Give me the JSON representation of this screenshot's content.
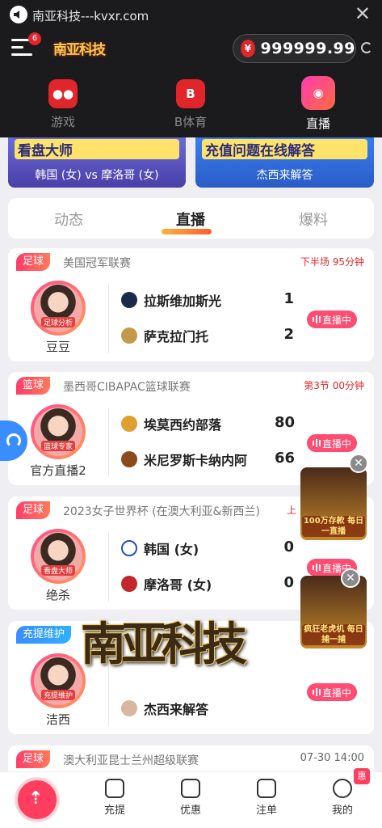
{
  "browser": {
    "url": "南亚科技---kvxr.com"
  },
  "header": {
    "menu_badge": "6",
    "logo": "南亚科技",
    "currency": "¥",
    "balance": "999999.99"
  },
  "categories": [
    {
      "label": "游戏"
    },
    {
      "label": "B体育"
    },
    {
      "label": "直播"
    }
  ],
  "banners": [
    {
      "title": "看盘大师",
      "label": "韩国 (女) vs 摩洛哥 (女)"
    },
    {
      "title": "充值问题在线解答",
      "label": "杰西来解答"
    }
  ],
  "tabs": [
    "动态",
    "直播",
    "爆料"
  ],
  "cards": [
    {
      "sport": "足球",
      "league": "美国冠军联赛",
      "status": "下半场 95分钟",
      "anchor": "豆豆",
      "avatar_text": "足球分析",
      "home": "拉斯维加斯光",
      "away": "萨克拉门托",
      "home_score": "1",
      "away_score": "2",
      "live": "直播中"
    },
    {
      "sport": "篮球",
      "league": "墨西哥CIBAPAC篮球联赛",
      "status": "第3节 00分钟",
      "anchor": "官方直播2",
      "avatar_text": "篮球专家",
      "home": "埃莫西约部落",
      "away": "米尼罗斯卡纳内阿",
      "home_score": "80",
      "away_score": "66",
      "live": "直播中"
    },
    {
      "sport": "足球",
      "league": "2023女子世界杯 (在澳大利亚&新西兰)",
      "status": "上",
      "anchor": "绝杀",
      "avatar_text": "看盘大师",
      "home": "韩国 (女)",
      "away": "摩洛哥 (女)",
      "home_score": "0",
      "away_score": "0",
      "live": "直播中"
    },
    {
      "sport": "充提维护",
      "league": "",
      "status": "",
      "anchor": "洁西",
      "avatar_text": "充提维护",
      "home": "",
      "away": "杰西来解答",
      "home_score": "",
      "away_score": "",
      "live": "直播中"
    },
    {
      "sport": "足球",
      "league": "澳大利亚昆士兰州超级联赛",
      "status": "07-30 14:00"
    }
  ],
  "ads": [
    {
      "text": "100万存款 每日一直播"
    },
    {
      "text": "疯狂老虎机 每日捕一捕"
    }
  ],
  "watermark": "南亚科技",
  "bottom_nav": [
    {
      "label": "充提"
    },
    {
      "label": "优惠"
    },
    {
      "label": "注单"
    },
    {
      "label": "我的"
    }
  ],
  "promo_badge": "惠",
  "colors": {
    "accent": "#ff3d5e",
    "live": "#ff4c72",
    "dark": "#1b1b1d"
  }
}
